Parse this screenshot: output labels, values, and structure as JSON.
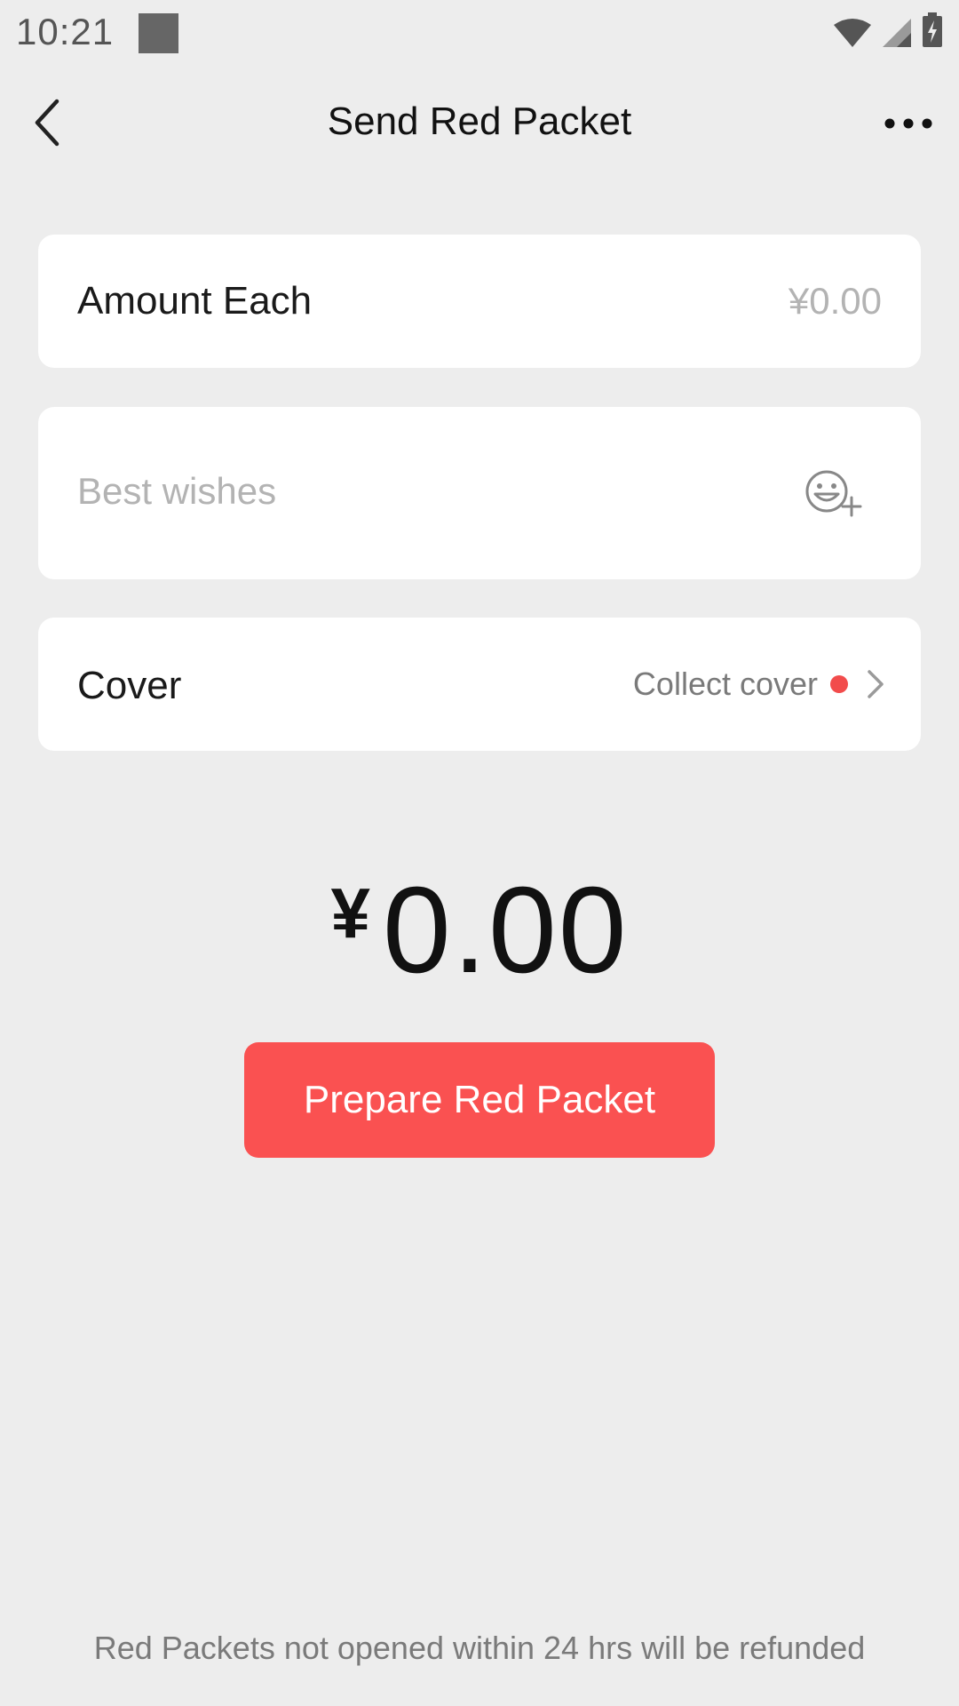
{
  "status_bar": {
    "time": "10:21",
    "icons": [
      "wifi-icon",
      "cellular-signal-icon",
      "battery-charging-icon"
    ]
  },
  "nav": {
    "title": "Send Red Packet",
    "back_icon": "chevron-left-icon",
    "more_icon": "more-dots-icon"
  },
  "amount_card": {
    "label": "Amount Each",
    "placeholder": "¥0.00"
  },
  "wishes_card": {
    "placeholder": "Best wishes",
    "emoji_icon": "emoji-add-icon"
  },
  "cover_card": {
    "label": "Cover",
    "link": "Collect cover"
  },
  "total": {
    "currency": "¥",
    "amount": "0.00"
  },
  "prepare_button": "Prepare Red Packet",
  "footer_note": "Red Packets not opened within 24 hrs will be refunded",
  "colors": {
    "background": "#ededed",
    "accent": "#fa5151",
    "notification_dot": "#f24c4c"
  }
}
